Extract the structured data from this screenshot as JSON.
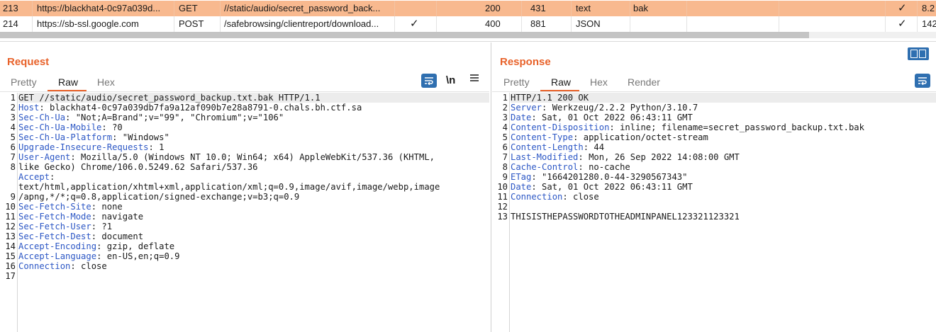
{
  "history": {
    "rows": [
      {
        "num": "213",
        "host": "https://blackhat4-0c97a039d...",
        "method": "GET",
        "url": "//static/audio/secret_password_back...",
        "params": "",
        "status": "200",
        "length": "431",
        "mime": "text",
        "ext": "bak",
        "tls": "✓",
        "ip": "8.2"
      },
      {
        "num": "214",
        "host": "https://sb-ssl.google.com",
        "method": "POST",
        "url": "/safebrowsing/clientreport/download...",
        "params": "✓",
        "status": "400",
        "length": "881",
        "mime": "JSON",
        "ext": "",
        "tls": "✓",
        "ip": "142"
      }
    ]
  },
  "request": {
    "title": "Request",
    "tabs": [
      "Pretty",
      "Raw",
      "Hex"
    ],
    "active_tab": "Raw",
    "newline_label": "\\n",
    "line_numbers": [
      "1",
      "2",
      "3",
      "4",
      "5",
      "6",
      "7",
      "8",
      "",
      "",
      "9",
      "10",
      "11",
      "12",
      "13",
      "14",
      "15",
      "16",
      "17"
    ],
    "lines": [
      {
        "name": "",
        "value": "GET //static/audio/secret_password_backup.txt.bak HTTP/1.1"
      },
      {
        "name": "Host",
        "value": ": blackhat4-0c97a039db7fa9a12af090b7e28a8791-0.chals.bh.ctf.sa"
      },
      {
        "name": "Sec-Ch-Ua",
        "value": ": \"Not;A=Brand\";v=\"99\", \"Chromium\";v=\"106\""
      },
      {
        "name": "Sec-Ch-Ua-Mobile",
        "value": ": ?0"
      },
      {
        "name": "Sec-Ch-Ua-Platform",
        "value": ": \"Windows\""
      },
      {
        "name": "Upgrade-Insecure-Requests",
        "value": ": 1"
      },
      {
        "name": "User-Agent",
        "value": ": Mozilla/5.0 (Windows NT 10.0; Win64; x64) AppleWebKit/537.36 (KHTML,"
      },
      {
        "name": "",
        "value": "like Gecko) Chrome/106.0.5249.62 Safari/537.36"
      },
      {
        "name": "Accept",
        "value": ":"
      },
      {
        "name": "",
        "value": "text/html,application/xhtml+xml,application/xml;q=0.9,image/avif,image/webp,image"
      },
      {
        "name": "",
        "value": "/apng,*/*;q=0.8,application/signed-exchange;v=b3;q=0.9"
      },
      {
        "name": "Sec-Fetch-Site",
        "value": ": none"
      },
      {
        "name": "Sec-Fetch-Mode",
        "value": ": navigate"
      },
      {
        "name": "Sec-Fetch-User",
        "value": ": ?1"
      },
      {
        "name": "Sec-Fetch-Dest",
        "value": ": document"
      },
      {
        "name": "Accept-Encoding",
        "value": ": gzip, deflate"
      },
      {
        "name": "Accept-Language",
        "value": ": en-US,en;q=0.9"
      },
      {
        "name": "Connection",
        "value": ": close"
      },
      {
        "name": "",
        "value": ""
      },
      {
        "name": "",
        "value": ""
      }
    ]
  },
  "response": {
    "title": "Response",
    "tabs": [
      "Pretty",
      "Raw",
      "Hex",
      "Render"
    ],
    "active_tab": "Raw",
    "line_numbers": [
      "1",
      "2",
      "3",
      "4",
      "5",
      "6",
      "7",
      "8",
      "9",
      "10",
      "11",
      "12",
      "13"
    ],
    "lines": [
      {
        "name": "",
        "value": "HTTP/1.1 200 OK"
      },
      {
        "name": "Server",
        "value": ": Werkzeug/2.2.2 Python/3.10.7"
      },
      {
        "name": "Date",
        "value": ": Sat, 01 Oct 2022 06:43:11 GMT"
      },
      {
        "name": "Content-Disposition",
        "value": ": inline; filename=secret_password_backup.txt.bak"
      },
      {
        "name": "Content-Type",
        "value": ": application/octet-stream"
      },
      {
        "name": "Content-Length",
        "value": ": 44"
      },
      {
        "name": "Last-Modified",
        "value": ": Mon, 26 Sep 2022 14:08:00 GMT"
      },
      {
        "name": "Cache-Control",
        "value": ": no-cache"
      },
      {
        "name": "ETag",
        "value": ": \"1664201280.0-44-3290567343\""
      },
      {
        "name": "Date",
        "value": ": Sat, 01 Oct 2022 06:43:11 GMT"
      },
      {
        "name": "Connection",
        "value": ": close"
      },
      {
        "name": "",
        "value": ""
      },
      {
        "name": "",
        "value": "THISISTHEPASSWORDTOTHEADMINPANEL123321123321"
      }
    ]
  },
  "colors": {
    "accent": "#e8622a",
    "selected_row": "#f8b98f",
    "header_name": "#2c57c5",
    "button": "#2f6fb0"
  }
}
